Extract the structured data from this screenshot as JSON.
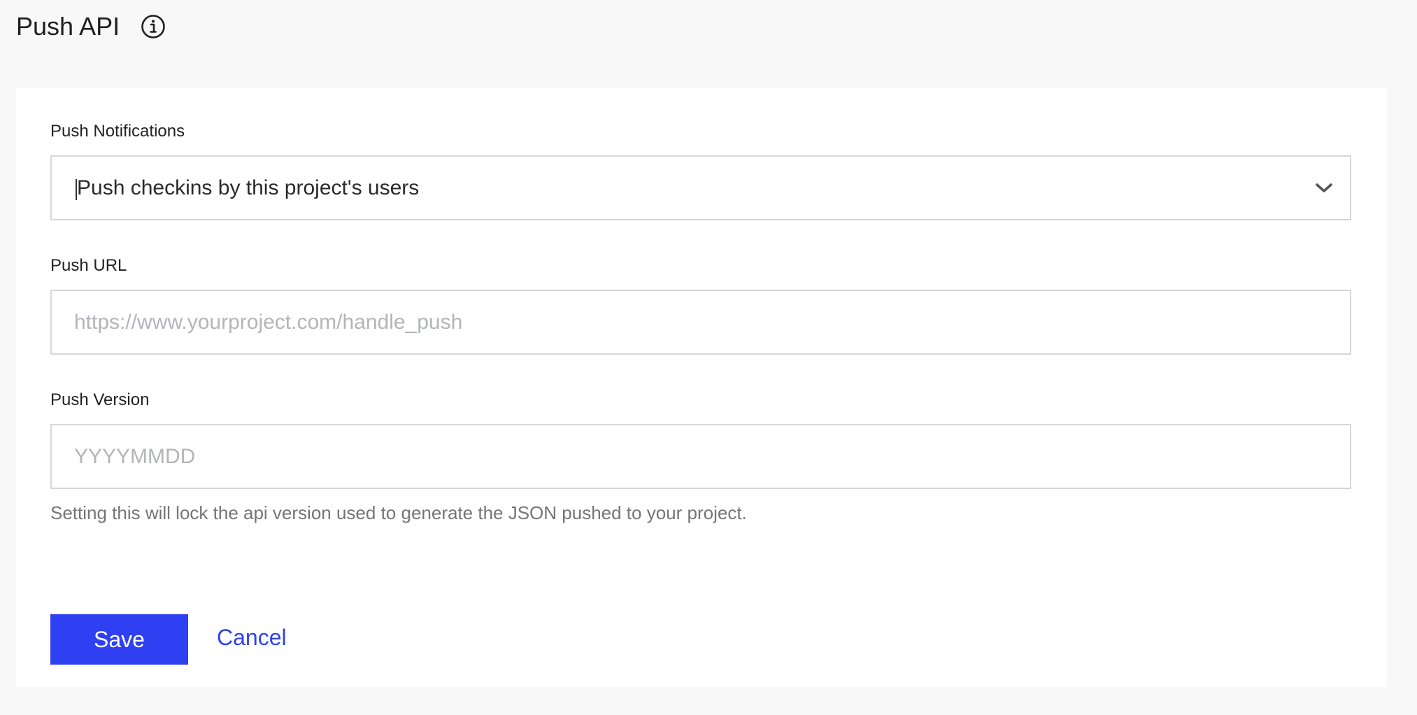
{
  "header": {
    "title": "Push API",
    "info_icon": "info-circle-icon"
  },
  "form": {
    "push_notifications": {
      "label": "Push Notifications",
      "selected": "Push checkins by this project's users",
      "chevron_icon": "chevron-down-icon"
    },
    "push_url": {
      "label": "Push URL",
      "value": "",
      "placeholder": "https://www.yourproject.com/handle_push"
    },
    "push_version": {
      "label": "Push Version",
      "value": "",
      "placeholder": "YYYYMMDD",
      "help": "Setting this will lock the api version used to generate the JSON pushed to your project."
    }
  },
  "actions": {
    "save_label": "Save",
    "cancel_label": "Cancel"
  },
  "colors": {
    "page_background": "#f9f8f8",
    "card_background": "#ffffff",
    "accent": "#2f3ff2",
    "border": "#d7d7d7",
    "placeholder": "#b4b5b9",
    "help_text": "#757575"
  }
}
